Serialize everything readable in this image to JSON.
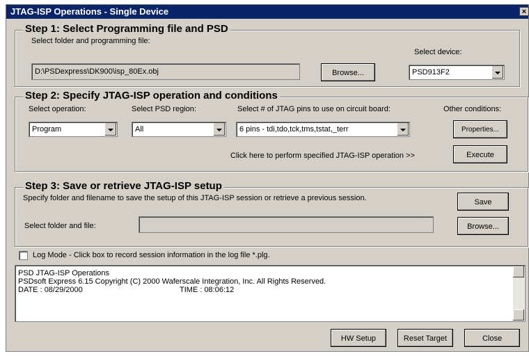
{
  "window": {
    "title": "JTAG-ISP Operations - Single Device",
    "close_glyph": "×"
  },
  "step1": {
    "header": "Step 1: Select Programming file and PSD",
    "folder_label": "Select folder and programming file:",
    "file_value": "D:\\PSDexpress\\DK900\\isp_80Ex.obj",
    "browse_label": "Browse...",
    "device_label": "Select device:",
    "device_value": "PSD913F2"
  },
  "step2": {
    "header": "Step 2: Specify JTAG-ISP operation and conditions",
    "operation_label": "Select operation:",
    "operation_value": "Program",
    "region_label": "Select PSD region:",
    "region_value": "All",
    "pins_label": "Select # of JTAG pins to use on circuit board:",
    "pins_value": "6 pins - tdi,tdo,tck,tms,tstat,_terr",
    "other_label": "Other conditions:",
    "properties_label": "Properties...",
    "execute_hint": "Click here to perform specified JTAG-ISP operation >>",
    "execute_label": "Execute"
  },
  "step3": {
    "header": "Step 3: Save or retrieve JTAG-ISP setup",
    "description": "Specify folder and filename to save the setup of this JTAG-ISP session or retrieve a previous session.",
    "save_label": "Save",
    "file_label": "Select folder and file:",
    "file_value": "",
    "browse_label": "Browse..."
  },
  "log_mode": {
    "label": "Log Mode - Click box to record session information in the log file *.plg.",
    "checked": false
  },
  "log": {
    "line1": "PSD JTAG-ISP Operations",
    "line2": "PSDsoft Express 6.15 Copyright (C) 2000 Waferscale Integration, Inc.  All Rights Reserved.",
    "date": "DATE : 08/29/2000",
    "time": "TIME : 08:06:12"
  },
  "footer": {
    "hw_setup_label": "HW Setup",
    "reset_target_label": "Reset Target",
    "close_label": "Close"
  }
}
